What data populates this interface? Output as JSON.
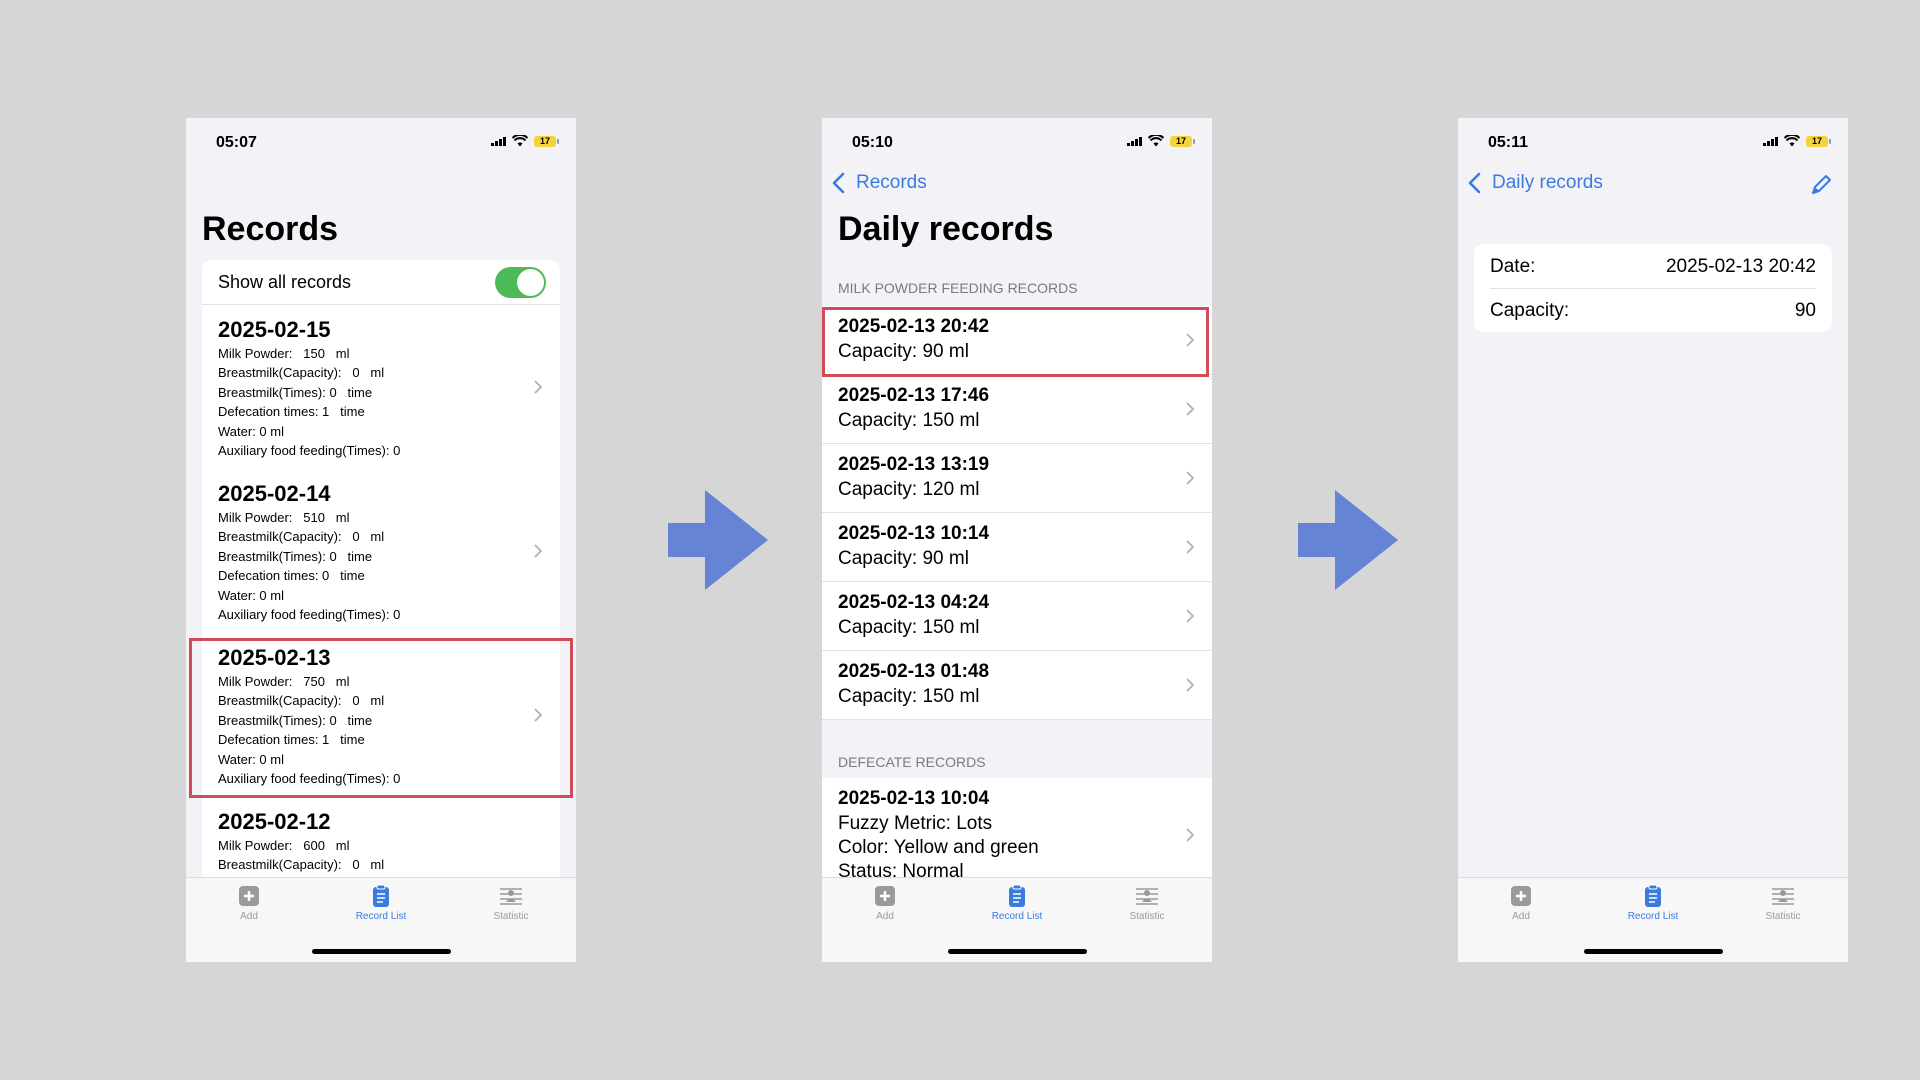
{
  "colors": {
    "accent": "#3b7be0",
    "highlight": "#d24b5a",
    "arrow": "#6684d6",
    "toggle_on": "#4cba57"
  },
  "tabs": {
    "add": "Add",
    "record_list": "Record List",
    "statistic": "Statistic"
  },
  "screen1": {
    "time": "05:07",
    "battery": "17",
    "title": "Records",
    "toggle_label": "Show all records",
    "days": [
      {
        "date": "2025-02-15",
        "lines": [
          "Milk Powder:   150   ml",
          "Breastmilk(Capacity):   0   ml",
          "Breastmilk(Times): 0   time",
          "Defecation times: 1   time",
          "Water: 0 ml",
          "Auxiliary food feeding(Times): 0"
        ]
      },
      {
        "date": "2025-02-14",
        "lines": [
          "Milk Powder:   510   ml",
          "Breastmilk(Capacity):   0   ml",
          "Breastmilk(Times): 0   time",
          "Defecation times: 0   time",
          "Water: 0 ml",
          "Auxiliary food feeding(Times): 0"
        ]
      },
      {
        "date": "2025-02-13",
        "lines": [
          "Milk Powder:   750   ml",
          "Breastmilk(Capacity):   0   ml",
          "Breastmilk(Times): 0   time",
          "Defecation times: 1   time",
          "Water: 0 ml",
          "Auxiliary food feeding(Times): 0"
        ]
      },
      {
        "date": "2025-02-12",
        "lines": [
          "Milk Powder:   600   ml",
          "Breastmilk(Capacity):   0   ml"
        ]
      }
    ]
  },
  "screen2": {
    "time": "05:10",
    "battery": "17",
    "back_label": "Records",
    "title": "Daily records",
    "section_milk": "MILK POWDER FEEDING RECORDS",
    "records": [
      {
        "time": "2025-02-13 20:42",
        "capacity": "Capacity: 90 ml"
      },
      {
        "time": "2025-02-13 17:46",
        "capacity": "Capacity: 150 ml"
      },
      {
        "time": "2025-02-13 13:19",
        "capacity": "Capacity: 120 ml"
      },
      {
        "time": "2025-02-13 10:14",
        "capacity": "Capacity: 90 ml"
      },
      {
        "time": "2025-02-13 04:24",
        "capacity": "Capacity: 150 ml"
      },
      {
        "time": "2025-02-13 01:48",
        "capacity": "Capacity: 150 ml"
      }
    ],
    "section_defecate": "DEFECATE RECORDS",
    "defecate": {
      "time": "2025-02-13 10:04",
      "fuzzy": "Fuzzy Metric:  Lots",
      "color": "Color:  Yellow and green",
      "status": "Status:  Normal"
    }
  },
  "screen3": {
    "time": "05:11",
    "battery": "17",
    "back_label": "Daily records",
    "date_label": "Date:",
    "date_value": "2025-02-13 20:42",
    "capacity_label": "Capacity:",
    "capacity_value": "90"
  }
}
